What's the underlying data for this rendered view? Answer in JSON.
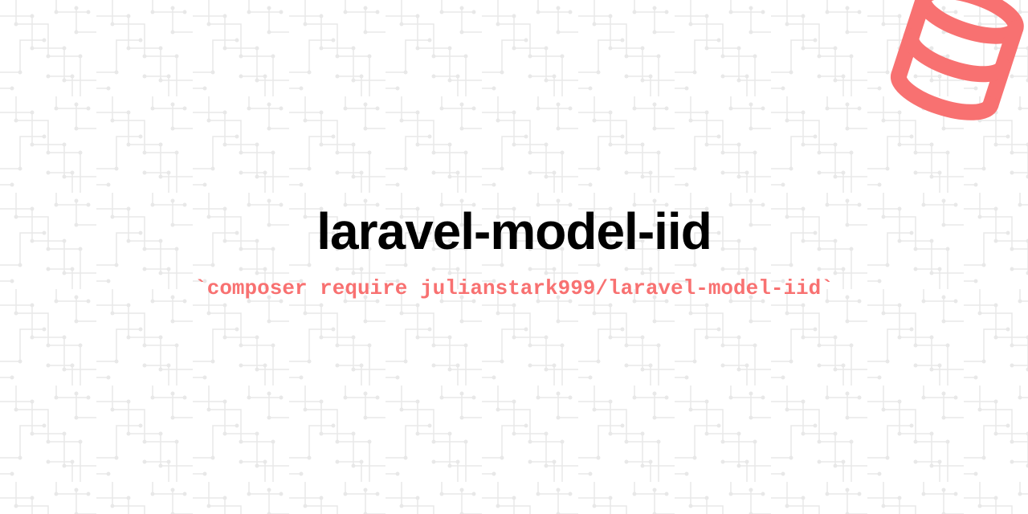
{
  "title": "laravel-model-iid",
  "command": "`composer require julianstark999/laravel-model-iid`",
  "accent_color": "#f87171",
  "icon": "database-icon"
}
